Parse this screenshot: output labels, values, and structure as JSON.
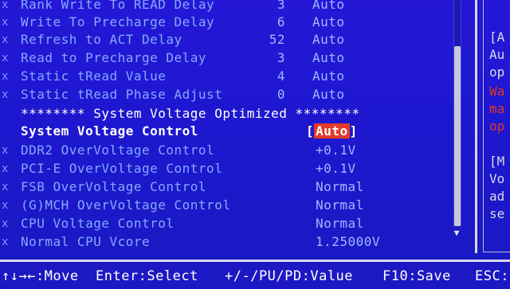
{
  "settings": [
    {
      "mark": "x",
      "label": "Rank Write To READ Delay",
      "value": "3",
      "mode": "Auto"
    },
    {
      "mark": "x",
      "label": "Write To Precharge Delay",
      "value": "6",
      "mode": "Auto"
    },
    {
      "mark": "x",
      "label": "Refresh to ACT Delay",
      "value": "52",
      "mode": "Auto"
    },
    {
      "mark": "x",
      "label": "Read to Precharge Delay",
      "value": "3",
      "mode": "Auto"
    },
    {
      "mark": "x",
      "label": "Static tRead Value",
      "value": "4",
      "mode": "Auto"
    },
    {
      "mark": "x",
      "label": "Static tRead Phase Adjust",
      "value": "0",
      "mode": "Auto"
    }
  ],
  "section_header": "******** System Voltage Optimized ********",
  "voltage_control": {
    "label": "System Voltage Control",
    "bracket_open": "[",
    "value": "Auto",
    "bracket_close": "]"
  },
  "voltage_items": [
    {
      "mark": "x",
      "label": "DDR2 OverVoltage Control",
      "value": "+0.1V"
    },
    {
      "mark": "x",
      "label": "PCI-E OverVoltage Control",
      "value": "+0.1V"
    },
    {
      "mark": "x",
      "label": "FSB OverVoltage Control",
      "value": "Normal"
    },
    {
      "mark": "x",
      "label": "(G)MCH OverVoltage Control",
      "value": "Normal"
    },
    {
      "mark": "x",
      "label": "CPU Voltage Control",
      "value": "Normal"
    },
    {
      "mark": "x",
      "label": "Normal CPU Vcore",
      "value": "1.25000V"
    }
  ],
  "scrollbar": {
    "down_arrow": "▼"
  },
  "help": {
    "lines_top": [
      "[A",
      "Au",
      "op"
    ],
    "lines_red": [
      "Wa",
      "ma",
      "op"
    ],
    "lines_bottom": [
      "[M",
      "Vo",
      "ad",
      "se"
    ]
  },
  "footer": {
    "move": "↑↓→←:Move",
    "select": "Enter:Select",
    "value": "+/-/PU/PD:Value",
    "save": "F10:Save",
    "esc": "ESC:"
  },
  "colors": {
    "background": "#1d14c8",
    "highlight": "#e23a2b",
    "text": "#86a8ff",
    "help_warning": "#e5362b"
  }
}
